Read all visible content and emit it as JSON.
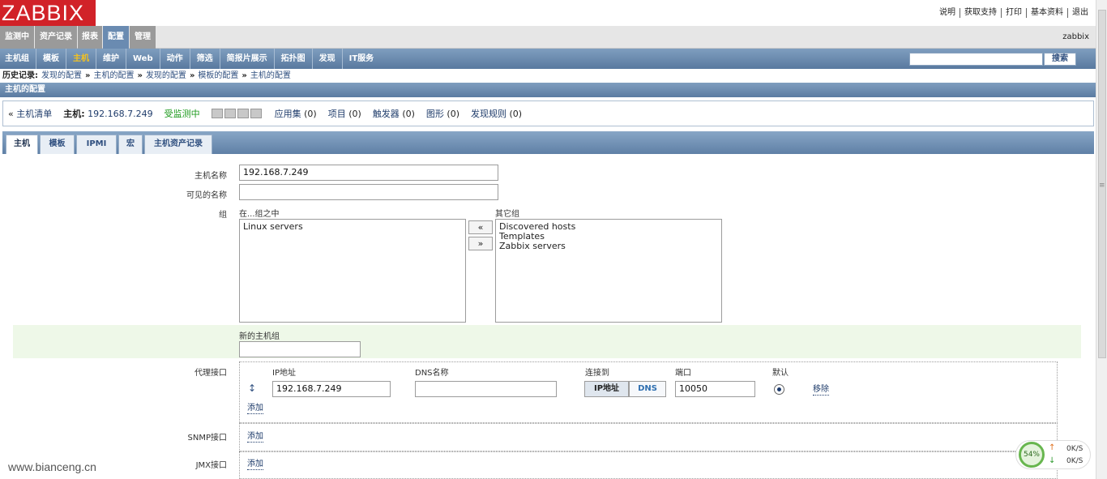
{
  "app": {
    "logo": "ZABBIX",
    "username": "zabbix"
  },
  "top_links": [
    "说明",
    "获取支持",
    "打印",
    "基本资料",
    "退出"
  ],
  "main_menu": [
    "监测中",
    "资产记录",
    "报表",
    "配置",
    "管理"
  ],
  "sub_menu": [
    "主机组",
    "模板",
    "主机",
    "维护",
    "Web",
    "动作",
    "筛选",
    "简报片展示",
    "拓扑图",
    "发现",
    "IT服务"
  ],
  "search": {
    "value": "",
    "button": "搜索"
  },
  "history": {
    "label": "历史记录:",
    "items": [
      "发现的配置",
      "主机的配置",
      "发现的配置",
      "模板的配置",
      "主机的配置"
    ],
    "separator": "»"
  },
  "page_title": "主机的配置",
  "host_nav": {
    "back_prefix": "«",
    "host_list": "主机清单",
    "host_label": "主机:",
    "host_value": "192.168.7.249",
    "status": "受监测中",
    "applications": "应用集",
    "applications_count": "(0)",
    "items": "项目",
    "items_count": "(0)",
    "triggers": "触发器",
    "triggers_count": "(0)",
    "graphs": "图形",
    "graphs_count": "(0)",
    "discovery": "发现规则",
    "discovery_count": "(0)"
  },
  "tabs": [
    "主机",
    "模板",
    "IPMI",
    "宏",
    "主机资产记录"
  ],
  "form": {
    "hostname_label": "主机名称",
    "hostname_value": "192.168.7.249",
    "visible_name_label": "可见的名称",
    "visible_name_value": "",
    "groups_label": "组",
    "in_groups_label": "在...组之中",
    "in_groups": [
      "Linux servers"
    ],
    "other_groups_label": "其它组",
    "other_groups": [
      "Discovered hosts",
      "Templates",
      "Zabbix servers"
    ],
    "move_left": "«",
    "move_right": "»",
    "new_group_label": "新的主机组",
    "new_group_value": "",
    "agent_iface_label": "代理接口",
    "col_ip": "IP地址",
    "col_dns": "DNS名称",
    "col_connect": "连接到",
    "col_port": "端口",
    "col_default": "默认",
    "ip_value": "192.168.7.249",
    "dns_value": "",
    "connect_ip": "IP地址",
    "connect_dns": "DNS",
    "port_value": "10050",
    "remove": "移除",
    "add": "添加",
    "snmp_label": "SNMP接口",
    "jmx_label": "JMX接口"
  },
  "watermark": "www.bianceng.cn",
  "net_widget": {
    "percent": "54%",
    "up": "0K/S",
    "down": "0K/S"
  },
  "colors": {
    "brand": "#d12228",
    "menu_blue": "#6a8bb1",
    "selected_sub": "#f7c31c",
    "status_green": "#1d9a1d"
  }
}
